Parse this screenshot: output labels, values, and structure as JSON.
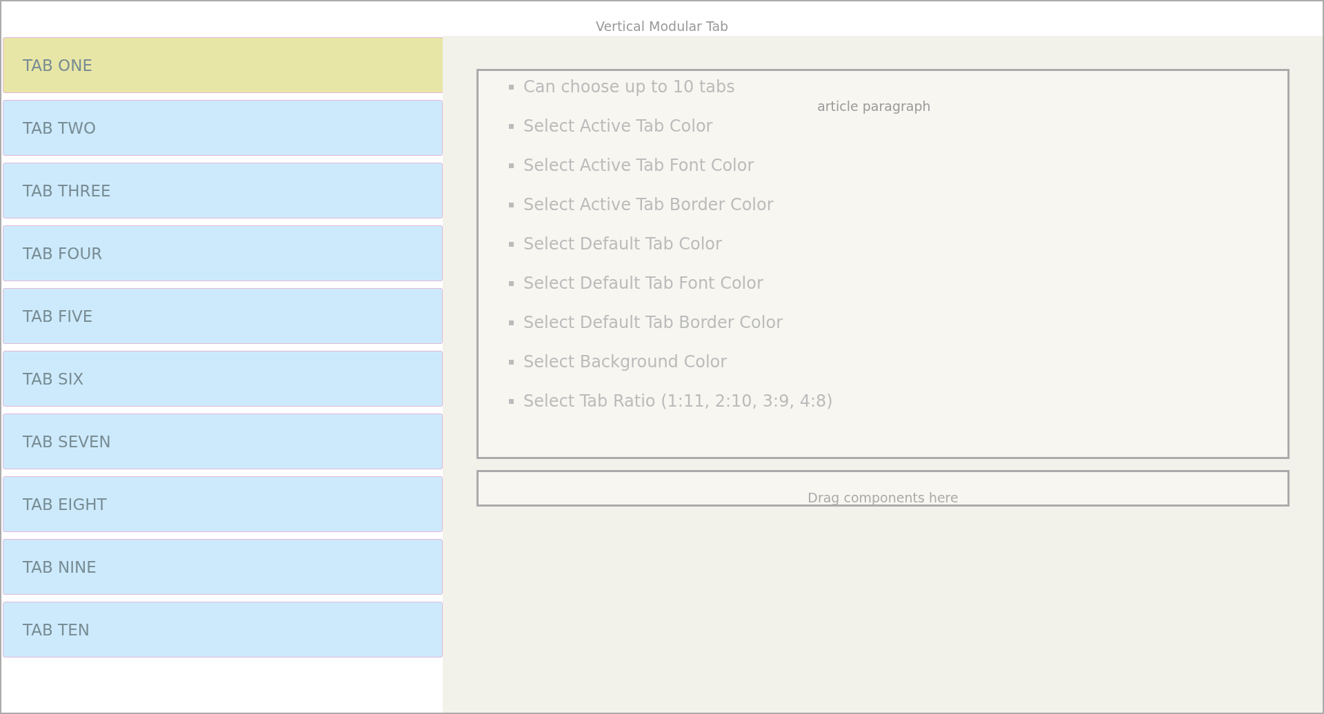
{
  "header": {
    "title": "Vertical Modular Tab"
  },
  "tabs": [
    {
      "label": "TAB ONE",
      "selected": true
    },
    {
      "label": "TAB TWO",
      "selected": false
    },
    {
      "label": "TAB THREE",
      "selected": false
    },
    {
      "label": "TAB FOUR",
      "selected": false
    },
    {
      "label": "TAB FIVE",
      "selected": false
    },
    {
      "label": "TAB SIX",
      "selected": false
    },
    {
      "label": "TAB SEVEN",
      "selected": false
    },
    {
      "label": "TAB EIGHT",
      "selected": false
    },
    {
      "label": "TAB NINE",
      "selected": false
    },
    {
      "label": "TAB TEN",
      "selected": false
    }
  ],
  "article": {
    "items": [
      "Can choose up to 10 tabs",
      "Select Active Tab Color",
      "Select Active Tab Font Color",
      "Select Active Tab Border Color",
      "Select Default Tab Color",
      "Select Default Tab Font Color",
      "Select Default Tab Border Color",
      "Select Background Color",
      "Select Tab Ratio (1:11, 2:10, 3:9, 4:8)"
    ],
    "label": "article paragraph"
  },
  "drop_zone": {
    "label": "Drag components here"
  }
}
